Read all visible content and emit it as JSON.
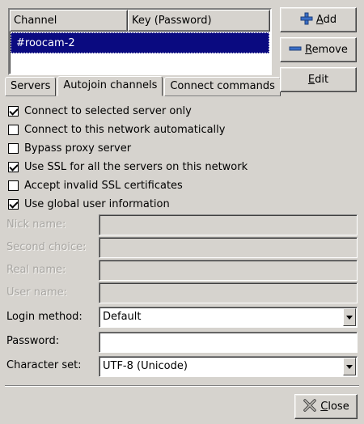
{
  "table": {
    "headers": {
      "channel": "Channel",
      "key": "Key (Password)"
    },
    "rows": [
      {
        "channel": "#roocam-2",
        "key": ""
      }
    ]
  },
  "tabs": [
    {
      "label": "Servers",
      "active": false
    },
    {
      "label": "Autojoin channels",
      "active": true
    },
    {
      "label": "Connect commands",
      "active": false
    }
  ],
  "buttons": {
    "add": {
      "mnemonic": "A",
      "rest": "dd"
    },
    "remove": {
      "mnemonic": "R",
      "rest": "emove"
    },
    "edit": {
      "mnemonic": "E",
      "rest": "dit"
    },
    "close": {
      "mnemonic": "C",
      "rest": "lose"
    }
  },
  "options": [
    {
      "label": "Connect to selected server only",
      "checked": true
    },
    {
      "label": "Connect to this network automatically",
      "checked": false
    },
    {
      "label": "Bypass proxy server",
      "checked": false
    },
    {
      "label": "Use SSL for all the servers on this network",
      "checked": true
    },
    {
      "label": "Accept invalid SSL certificates",
      "checked": false
    },
    {
      "label": "Use global user information",
      "checked": true
    }
  ],
  "fields": {
    "nick_name": {
      "label": "Nick name:",
      "value": ""
    },
    "second_choice": {
      "label": "Second choice:",
      "value": ""
    },
    "real_name": {
      "label": "Real name:",
      "value": ""
    },
    "user_name": {
      "label": "User name:",
      "value": ""
    },
    "login_method": {
      "label": "Login method:",
      "value": "Default"
    },
    "password": {
      "label": "Password:",
      "value": ""
    },
    "character_set": {
      "label": "Character set:",
      "value": "UTF-8 (Unicode)"
    }
  },
  "icons": {
    "add": "plus-icon",
    "remove": "minus-icon",
    "close": "close-icon",
    "dropdown": "chevron-down-icon"
  },
  "colors": {
    "selection": "#0a0a80",
    "window": "#d6d3ce",
    "add_icon": "#3a6fc8",
    "remove_icon": "#3a6fc8"
  }
}
